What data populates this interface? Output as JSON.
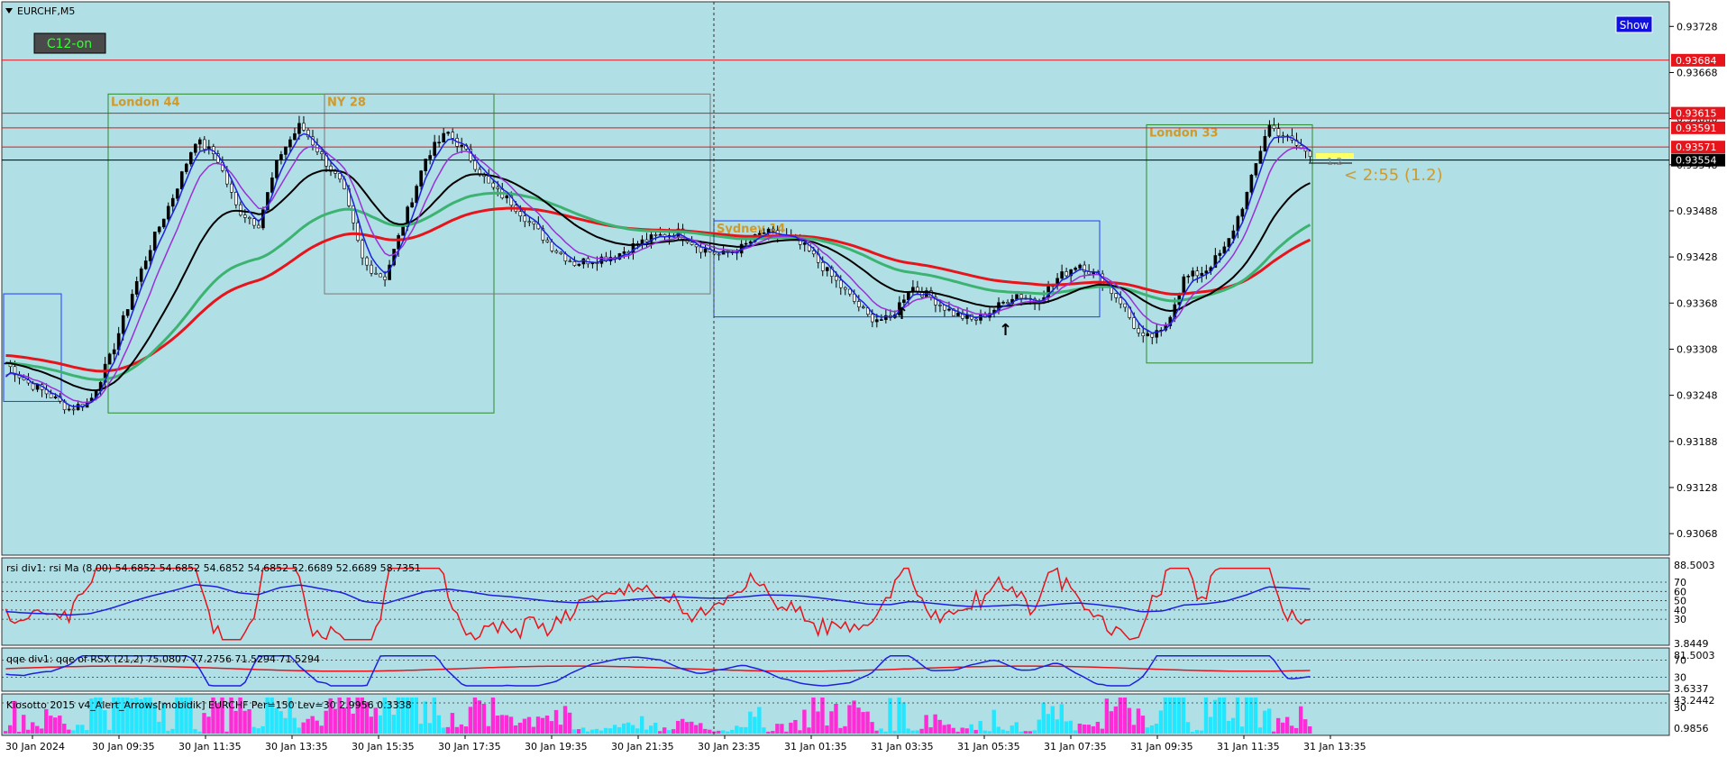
{
  "symbol_title": "EURCHF,M5",
  "c12_label": "C12-on",
  "show_button": "Show",
  "countdown": "< 2:55 (1.2)",
  "mini_label": "1.2",
  "colors": {
    "background": "#b0dfe5",
    "bull_candle": "#000000",
    "ema_red": "#e8141b",
    "ema_green": "#3cb371",
    "ema_black": "#000000",
    "ema_purple": "#9b30d9",
    "ema_blue": "#1f1fe0",
    "session_london": "#2e8b2e",
    "session_ny": "#7a7a7a",
    "session_sydney": "#1e3cff",
    "session_label": "#d09a2a",
    "price_tag_red": "#e8141b",
    "histogram_magenta": "#ff2bd6",
    "histogram_cyan": "#25e6ff"
  },
  "price_scale": {
    "labels": [
      "0.93728",
      "0.93668",
      "0.93608",
      "0.93548",
      "0.93488",
      "0.93428",
      "0.93368",
      "0.93308",
      "0.93248",
      "0.93188",
      "0.93128",
      "0.93068"
    ],
    "range": [
      0.9304,
      0.9376
    ]
  },
  "price_tags": [
    {
      "value": "0.93684",
      "price": 0.93684,
      "color": "#e8141b"
    },
    {
      "value": "0.93615",
      "price": 0.93615,
      "color": "#e8141b"
    },
    {
      "value": "0.93591",
      "price": 0.93596,
      "color": "#e8141b"
    },
    {
      "value": "0.93571",
      "price": 0.93571,
      "color": "#e8141b"
    },
    {
      "value": "0.93554",
      "price": 0.93554,
      "color": "#000000"
    }
  ],
  "sessions": [
    {
      "label": "London 44",
      "type": "london"
    },
    {
      "label": "NY 28",
      "type": "ny"
    },
    {
      "label": "Sydney 14",
      "type": "sydney"
    },
    {
      "label": "London 33",
      "type": "london"
    }
  ],
  "time_labels": [
    "30 Jan 2024",
    "30 Jan 09:35",
    "30 Jan 11:35",
    "30 Jan 13:35",
    "30 Jan 15:35",
    "30 Jan 17:35",
    "30 Jan 19:35",
    "30 Jan 21:35",
    "30 Jan 23:35",
    "31 Jan 01:35",
    "31 Jan 03:35",
    "31 Jan 05:35",
    "31 Jan 07:35",
    "31 Jan 09:35",
    "31 Jan 11:35",
    "31 Jan 13:35"
  ],
  "rsi_panel": {
    "title": "rsi div1: rsi Ma (8.00) 54.6852 54.6852 54.6852 54.6852 52.6689 52.6689 58.7351",
    "scale_labels": [
      "88.5003",
      "70",
      "60",
      "50",
      "40",
      "30",
      "3.8449"
    ],
    "levels": [
      70,
      60,
      50,
      40,
      30
    ]
  },
  "qqe_panel": {
    "title": "qqe div1: qqe of RSX (21,2) 75.0807 77.2756 71.5294 71.5294",
    "scale_labels": [
      "81.5003",
      "70",
      "30",
      "3.6337"
    ]
  },
  "kiosotto_panel": {
    "title": "Kiosotto 2015 v4_Alert_Arrows[mobidik] EURCHF Per=150 Lev=30 2.9956 0.3338",
    "scale_labels": [
      "43.2442",
      "30",
      "0.9856"
    ]
  },
  "chart_data": {
    "type": "candlestick",
    "symbol": "EURCHF",
    "timeframe": "M5",
    "x": [
      "30 Jan 2024",
      "30 Jan 09:35",
      "30 Jan 11:35",
      "30 Jan 13:35",
      "30 Jan 15:35",
      "30 Jan 17:35",
      "30 Jan 19:35",
      "30 Jan 21:35",
      "30 Jan 23:35",
      "31 Jan 01:35",
      "31 Jan 03:35",
      "31 Jan 05:35",
      "31 Jan 07:35",
      "31 Jan 09:35",
      "31 Jan 11:35",
      "31 Jan 13:35"
    ],
    "close_path": [
      0.9329,
      0.93265,
      0.9325,
      0.9323,
      0.9324,
      0.933,
      0.9338,
      0.9345,
      0.9351,
      0.9358,
      0.9356,
      0.9349,
      0.9347,
      0.9356,
      0.936,
      0.9356,
      0.9352,
      0.9342,
      0.934,
      0.9348,
      0.9356,
      0.9359,
      0.9356,
      0.9352,
      0.935,
      0.9347,
      0.9344,
      0.9342,
      0.93425,
      0.9343,
      0.93445,
      0.93455,
      0.9346,
      0.9344,
      0.9343,
      0.9344,
      0.9346,
      0.93455,
      0.9344,
      0.9341,
      0.9338,
      0.9335,
      0.93345,
      0.9339,
      0.93375,
      0.93355,
      0.93345,
      0.9336,
      0.9338,
      0.9337,
      0.934,
      0.9342,
      0.934,
      0.9337,
      0.9332,
      0.9333,
      0.934,
      0.9341,
      0.9344,
      0.9351,
      0.936,
      0.9358,
      0.9356
    ],
    "ylim": [
      0.9304,
      0.9376
    ],
    "moving_averages": [
      "red",
      "green",
      "black",
      "purple",
      "blue"
    ],
    "horizontal_levels": [
      0.93684,
      0.93615,
      0.93596,
      0.93571,
      0.93554
    ]
  }
}
